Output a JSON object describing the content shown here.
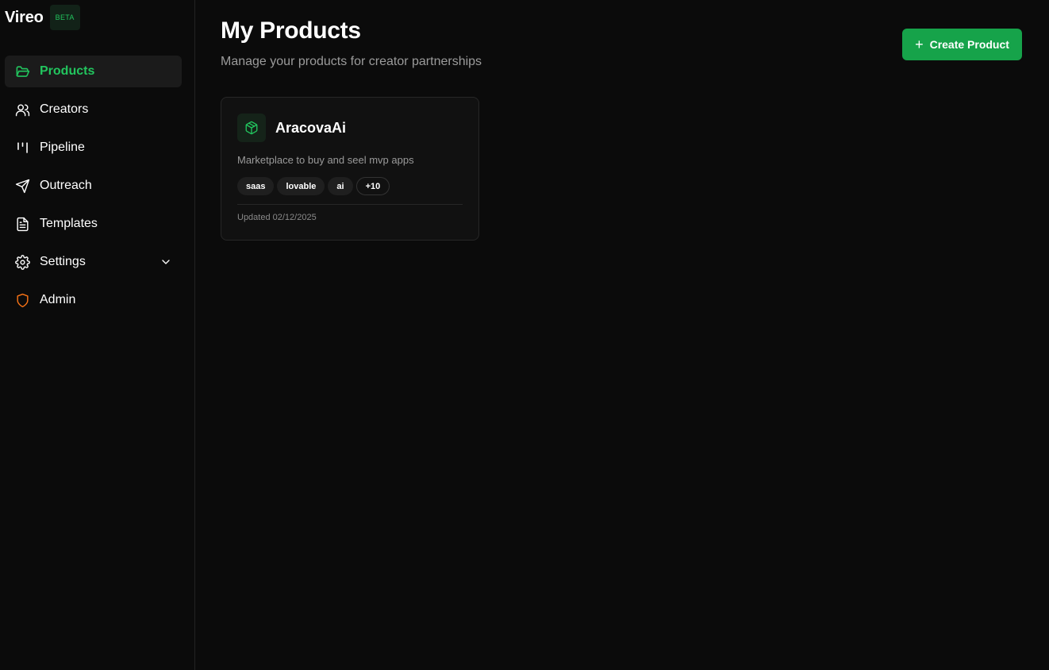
{
  "brand": {
    "name": "Vireo",
    "badge": "BETA"
  },
  "sidebar": {
    "items": [
      {
        "label": "Products",
        "icon": "folder-open-icon",
        "active": true
      },
      {
        "label": "Creators",
        "icon": "users-icon"
      },
      {
        "label": "Pipeline",
        "icon": "kanban-icon"
      },
      {
        "label": "Outreach",
        "icon": "send-icon"
      },
      {
        "label": "Templates",
        "icon": "file-text-icon"
      },
      {
        "label": "Settings",
        "icon": "gear-icon",
        "expandable": true
      },
      {
        "label": "Admin",
        "icon": "shield-icon"
      }
    ]
  },
  "header": {
    "title": "My Products",
    "subtitle": "Manage your products for creator partnerships",
    "create_button_label": "Create Product"
  },
  "products": [
    {
      "name": "AracovaAi",
      "description": "Marketplace to buy and seel mvp apps",
      "tags": [
        "saas",
        "lovable",
        "ai"
      ],
      "more_tags": "+10",
      "updated": "Updated 02/12/2025"
    }
  ],
  "colors": {
    "accent": "#22c55e",
    "button": "#16a34a",
    "admin_icon": "#f97316",
    "background": "#0b0b0b"
  }
}
